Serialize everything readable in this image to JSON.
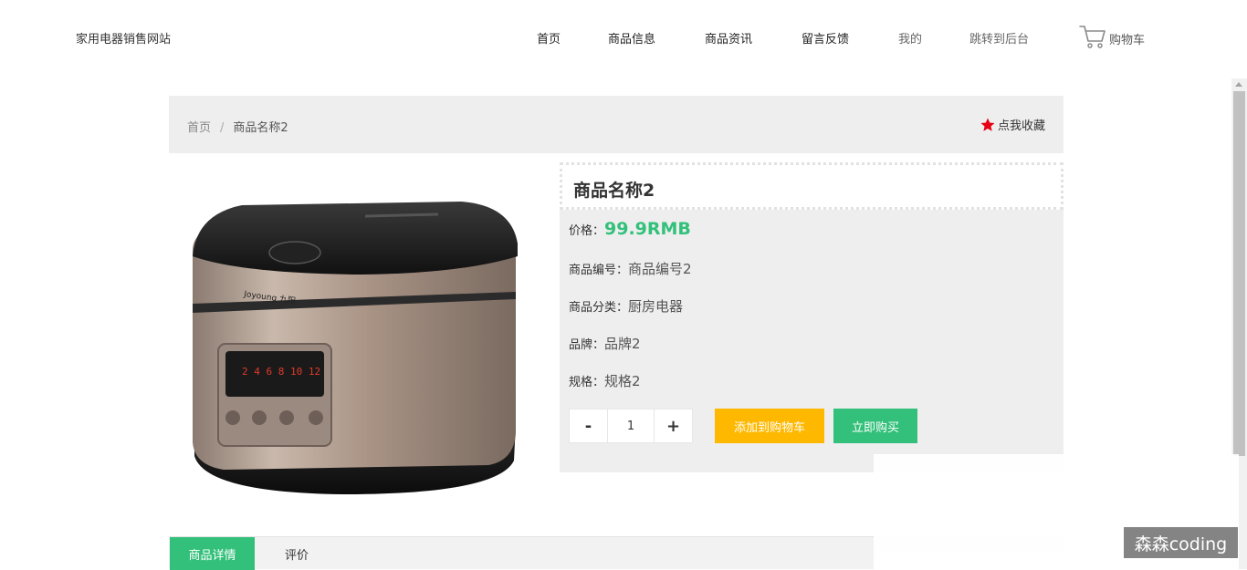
{
  "header": {
    "site_title": "家用电器销售网站",
    "nav": [
      {
        "label": "首页"
      },
      {
        "label": "商品信息"
      },
      {
        "label": "商品资讯"
      },
      {
        "label": "留言反馈"
      },
      {
        "label": "我的"
      },
      {
        "label": "跳转到后台"
      }
    ],
    "cart_label": "购物车",
    "cart_icon": "shopping-cart-icon"
  },
  "breadcrumb": {
    "home": "首页",
    "separator": "/",
    "current": "商品名称2"
  },
  "favorite": {
    "label": "点我收藏",
    "icon": "star-icon",
    "color": "#e60012"
  },
  "product": {
    "name": "商品名称2",
    "price_label": "价格：",
    "price": "99.9RMB",
    "code_label": "商品编号：",
    "code": "商品编号2",
    "category_label": "商品分类：",
    "category": "厨房电器",
    "brand_label": "品牌：",
    "brand": "品牌2",
    "spec_label": "规格：",
    "spec": "规格2",
    "image_brand_text": "Joyoung 九阳"
  },
  "purchase": {
    "minus": "-",
    "quantity": "1",
    "plus": "+",
    "add_to_cart": "添加到购物车",
    "buy_now": "立即购买"
  },
  "tabs": [
    {
      "label": "商品详情",
      "active": true
    },
    {
      "label": "评价",
      "active": false
    }
  ],
  "watermark": "森森coding",
  "colors": {
    "accent": "#33c07a",
    "cart_button": "#ffb800",
    "panel_bg": "#eeeeee"
  }
}
